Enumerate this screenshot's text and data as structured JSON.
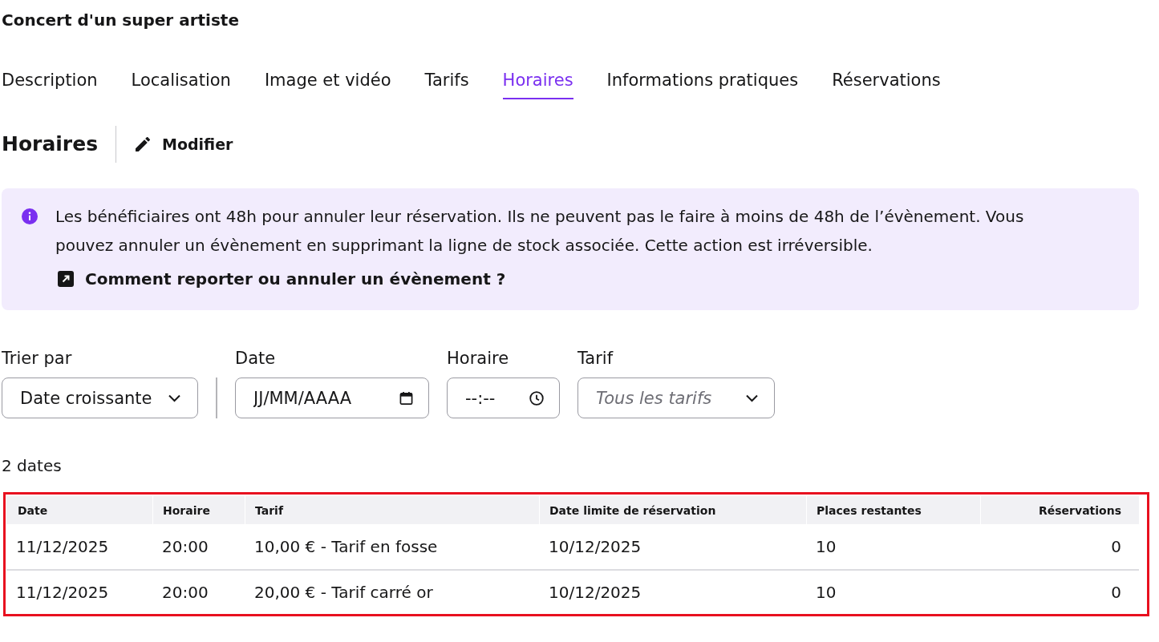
{
  "page_title": "Concert d'un super artiste",
  "tabs": [
    {
      "label": "Description",
      "selected": false
    },
    {
      "label": "Localisation",
      "selected": false
    },
    {
      "label": "Image et vidéo",
      "selected": false
    },
    {
      "label": "Tarifs",
      "selected": false
    },
    {
      "label": "Horaires",
      "selected": true
    },
    {
      "label": "Informations pratiques",
      "selected": false
    },
    {
      "label": "Réservations",
      "selected": false
    }
  ],
  "section": {
    "title": "Horaires",
    "edit_button": {
      "label": "Modifier"
    }
  },
  "notice": {
    "text": "Les bénéficiaires ont 48h pour annuler leur réservation. Ils ne peuvent pas le faire à moins de 48h de l’évènement. Vous pouvez annuler un évènement en supprimant la ligne de stock associée. Cette action est irréversible.",
    "link": {
      "label": "Comment reporter ou annuler un évènement ?"
    }
  },
  "sort": {
    "label": "Trier par",
    "value": "Date croissante"
  },
  "filters": [
    {
      "kind": "date",
      "label": "Date",
      "placeholder": "JJ/MM/AAAA"
    },
    {
      "kind": "time",
      "label": "Horaire",
      "placeholder": "--:--"
    },
    {
      "kind": "select",
      "label": "Tarif",
      "placeholder": "Tous les tarifs"
    }
  ],
  "result_count": "2 dates",
  "table": {
    "highlighted": true,
    "columns": [
      "Date",
      "Horaire",
      "Tarif",
      "Date limite de réservation",
      "Places restantes",
      "Réservations"
    ],
    "rows": [
      [
        "11/12/2025",
        "20:00",
        "10,00 € - Tarif en fosse",
        "10/12/2025",
        "10",
        "0"
      ],
      [
        "11/12/2025",
        "20:00",
        "20,00 € - Tarif carré or",
        "10/12/2025",
        "10",
        "0"
      ]
    ]
  }
}
